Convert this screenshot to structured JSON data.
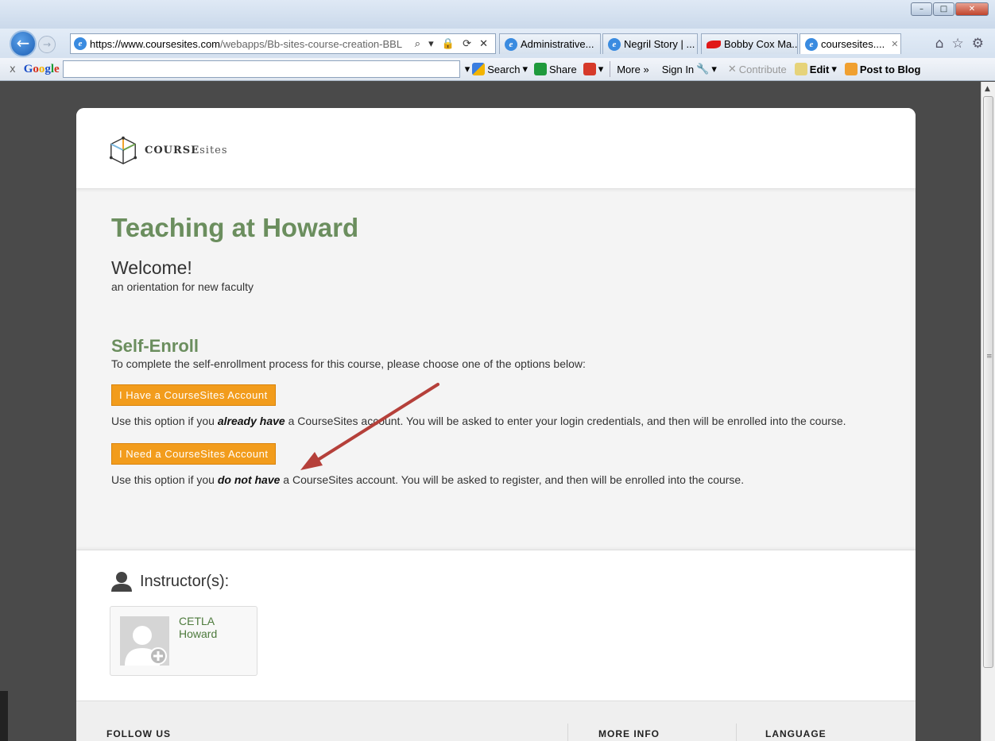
{
  "browser": {
    "url_domain": "https://www.coursesites.com",
    "url_rest": "/webapps/Bb-sites-course-creation-BBL",
    "addr_tools": "⌕ ▾ 🔒 ⟳ ✕",
    "tabs": [
      {
        "label": "Administrative...",
        "active": false
      },
      {
        "label": "Negril Story | ...",
        "active": false
      },
      {
        "label": "Bobby Cox Ma...",
        "active": false
      },
      {
        "label": "coursesites....",
        "active": true
      }
    ],
    "toolbar": {
      "close": "x",
      "search_label": "Search",
      "share_label": "Share",
      "more_label": "More »",
      "sign_in_label": "Sign In",
      "contribute_label": "Contribute",
      "edit_label": "Edit",
      "post_label": "Post to Blog"
    }
  },
  "logo": {
    "bold": "COURSE",
    "light": "sites"
  },
  "course": {
    "title": "Teaching at Howard",
    "welcome": "Welcome!",
    "subtitle": "an orientation for new faculty"
  },
  "enroll": {
    "title": "Self-Enroll",
    "instructions": "To complete the self-enrollment process for this course, please choose one of the options below:",
    "have_account_button": "I Have a CourseSites Account",
    "have_desc_pre": "Use this option if you ",
    "have_desc_em": "already have",
    "have_desc_post": " a CourseSites account. You will be asked to enter your login credentials, and then will be enrolled into the course.",
    "need_account_button": "I Need a CourseSites Account",
    "need_desc_pre": "Use this option if you ",
    "need_desc_em": "do not have",
    "need_desc_post": " a CourseSites account. You will be asked to register, and then will be enrolled into the course."
  },
  "instructors": {
    "heading": "Instructor(s):",
    "first_name": "CETLA",
    "last_name": "Howard"
  },
  "footer": {
    "follow": "FOLLOW US",
    "more_info": "MORE INFO",
    "language": "LANGUAGE"
  },
  "colors": {
    "accent_green": "#6b8e5e",
    "button_orange": "#f29c1c",
    "annotation_arrow": "#b5403a"
  }
}
